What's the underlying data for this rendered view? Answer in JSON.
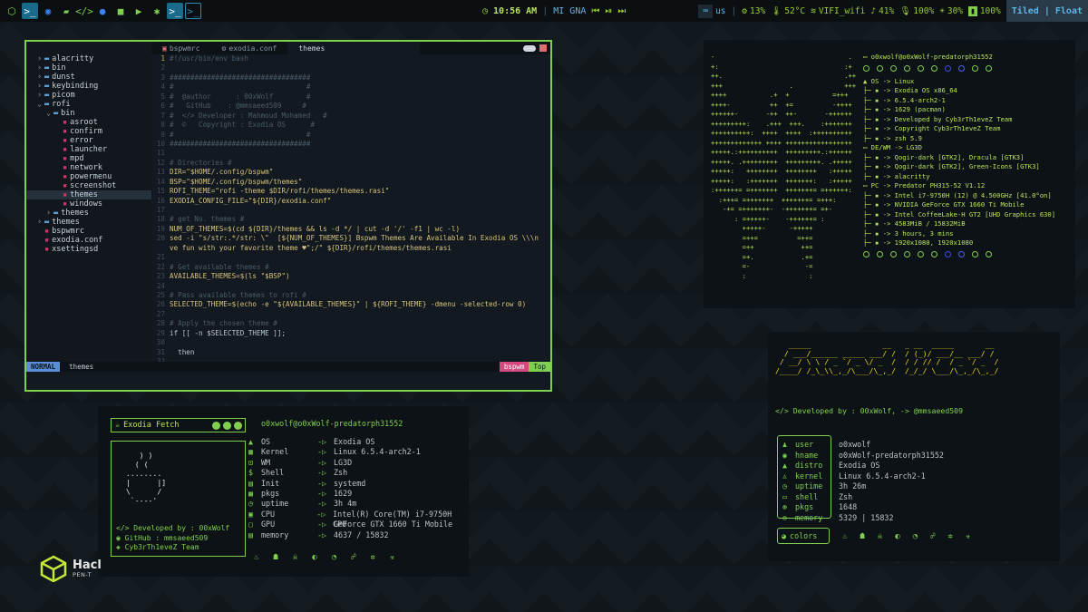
{
  "topbar": {
    "clock": "10:56 AM",
    "media": "MI GNA",
    "keyboard": "us",
    "cpu": "13%",
    "temp": "52°C",
    "wifi": "VIFI_wifi",
    "volume": "41%",
    "mic": "100%",
    "brightness": "30%",
    "battery": "100%",
    "layout_mode": "Tiled | Float"
  },
  "editor": {
    "tree": [
      {
        "label": "alacritty",
        "depth": 0,
        "type": "folder",
        "open": false
      },
      {
        "label": "bin",
        "depth": 0,
        "type": "folder",
        "open": false
      },
      {
        "label": "dunst",
        "depth": 0,
        "type": "folder",
        "open": false
      },
      {
        "label": "keybinding",
        "depth": 0,
        "type": "folder",
        "open": false
      },
      {
        "label": "picom",
        "depth": 0,
        "type": "folder",
        "open": false
      },
      {
        "label": "rofi",
        "depth": 0,
        "type": "folder",
        "open": true
      },
      {
        "label": "bin",
        "depth": 1,
        "type": "folder",
        "open": true
      },
      {
        "label": "asroot",
        "depth": 2,
        "type": "file"
      },
      {
        "label": "confirm",
        "depth": 2,
        "type": "file"
      },
      {
        "label": "error",
        "depth": 2,
        "type": "file"
      },
      {
        "label": "launcher",
        "depth": 2,
        "type": "file"
      },
      {
        "label": "mpd",
        "depth": 2,
        "type": "file"
      },
      {
        "label": "network",
        "depth": 2,
        "type": "file"
      },
      {
        "label": "powermenu",
        "depth": 2,
        "type": "file"
      },
      {
        "label": "screenshot",
        "depth": 2,
        "type": "file"
      },
      {
        "label": "themes",
        "depth": 2,
        "type": "file",
        "selected": true
      },
      {
        "label": "windows",
        "depth": 2,
        "type": "file"
      },
      {
        "label": "themes",
        "depth": 1,
        "type": "folder",
        "open": false
      },
      {
        "label": "themes",
        "depth": 0,
        "type": "folder",
        "open": false
      },
      {
        "label": "bspwmrc",
        "depth": 0,
        "type": "file"
      },
      {
        "label": "exodia.conf",
        "depth": 0,
        "type": "file"
      },
      {
        "label": "xsettingsd",
        "depth": 0,
        "type": "file"
      }
    ],
    "tabs": [
      "bspwmrc",
      "exodia.conf",
      "themes"
    ],
    "code": [
      {
        "n": "1",
        "t": "#!/usr/bin/env bash",
        "c": "com"
      },
      {
        "n": "2",
        "t": "",
        "c": ""
      },
      {
        "n": "3",
        "t": "##################################",
        "c": "com"
      },
      {
        "n": "4",
        "t": "#                                #",
        "c": "com"
      },
      {
        "n": "5",
        "t": "#  @author      : 00xWolf        #",
        "c": "com"
      },
      {
        "n": "6",
        "t": "#   GitHub    : @mmsaeed509     #",
        "c": "com"
      },
      {
        "n": "7",
        "t": "#  </> Developer : Mahmoud Mohamed   #",
        "c": "com"
      },
      {
        "n": "8",
        "t": "#  ©   Copyright : Exodia OS      #",
        "c": "com"
      },
      {
        "n": "9",
        "t": "#                                #",
        "c": "com"
      },
      {
        "n": "10",
        "t": "##################################",
        "c": "com"
      },
      {
        "n": "11",
        "t": "",
        "c": ""
      },
      {
        "n": "12",
        "t": "# Directories #",
        "c": "com"
      },
      {
        "n": "13",
        "t": "DIR=\"$HOME/.config/bspwm\"",
        "c": "str"
      },
      {
        "n": "14",
        "t": "BSP=\"$HOME/.config/bspwm/themes\"",
        "c": "str"
      },
      {
        "n": "15",
        "t": "ROFI_THEME=\"rofi -theme $DIR/rofi/themes/themes.rasi\"",
        "c": "str"
      },
      {
        "n": "16",
        "t": "EXODIA_CONFIG_FILE=\"${DIR}/exodia.conf\"",
        "c": "str"
      },
      {
        "n": "17",
        "t": "",
        "c": ""
      },
      {
        "n": "18",
        "t": "# get No. themes #",
        "c": "com"
      },
      {
        "n": "19",
        "t": "NUM_OF_THEMES=$(cd ${DIR}/themes && ls -d */ | cut -d '/' -f1 | wc -l)",
        "c": "str"
      },
      {
        "n": "20",
        "t": "sed -i \"s/str:.*/str: \\\"  [${NUM_OF_THEMES}] Bspwm Themes Are Available In Exodia OS \\\\\\n   Ha",
        "c": "str"
      },
      {
        "n": "",
        "t": "ve fun with your favorite theme ♥\";/\" ${DIR}/rofi/themes/themes.rasi",
        "c": "str"
      },
      {
        "n": "21",
        "t": "",
        "c": ""
      },
      {
        "n": "22",
        "t": "# Get available themes #",
        "c": "com"
      },
      {
        "n": "23",
        "t": "AVAILABLE_THEMES=$(ls \"$BSP\")",
        "c": "str"
      },
      {
        "n": "24",
        "t": "",
        "c": ""
      },
      {
        "n": "25",
        "t": "# Pass available themes to rofi #",
        "c": "com"
      },
      {
        "n": "26",
        "t": "SELECTED_THEME=$(echo -e \"${AVAILABLE_THEMES}\" | ${ROFI_THEME} -dmenu -selected-row 0)",
        "c": "str"
      },
      {
        "n": "27",
        "t": "",
        "c": ""
      },
      {
        "n": "28",
        "t": "# Apply the chosen theme #",
        "c": "com"
      },
      {
        "n": "29",
        "t": "if [[ -n $SELECTED_THEME ]];",
        "c": ""
      },
      {
        "n": "30",
        "t": "",
        "c": ""
      },
      {
        "n": "31",
        "t": "  then",
        "c": ""
      },
      {
        "n": "32",
        "t": "",
        "c": ""
      },
      {
        "n": "33",
        "t": "    THEME_PATH=\"$BSP/$SELECTED_THEME\"",
        "c": "str"
      }
    ],
    "status": {
      "mode": "NORMAL",
      "file": "themes",
      "branch": "bspwm",
      "position": "Top"
    }
  },
  "neofetch": {
    "art": "-                                  .\n+:                                :+\n++.                               .++\n+++                 .             +++\n++++           .+  +           =+++\n++++-          ++  +=          -++++\n++++++-       -++  ++-       -++++++\n+++++++++:    .+++  +++.    :+++++++\n++++++++++:  ++++  ++++  :++++++++++\n+++++++++++++ ++++ +++++++++++++++++\n+++++.:++++++++++  +++++++++.:++++++\n+++++. .+++++++++  +++++++++. .+++++\n+++++:   ++++++++  ++++++++   :+++++\n+++++:   :+++++++  +++++++:   :+++++\n:++++++= =+++++++  +++++++= =++++++:\n  :+++= =+++++++  +++++++= =+++:\n   -+= =+++++++-  -+++++++= =+-\n      : =+++++-    -++++++= :\n        +++++-      -+++++\n        =++=          =++=\n        =++            ++=\n        =+.            .+=\n        =-              -=\n        :                :",
    "user": "o0xwolf@o0xWolf-predatorph31552",
    "sections": [
      {
        "head": "OS",
        "items": [
          "Linux",
          "Exodia OS x86_64",
          "6.5.4-arch2-1",
          "1629 (pacman)",
          "Developed by Cyb3rTh1eveZ Team",
          "Copyright Cyb3rTh1eveZ Team",
          "zsh 5.9"
        ]
      },
      {
        "head": "DE/WM",
        "items": [
          "LG3D",
          "Qogir-dark [GTK2], Dracula [GTK3]",
          "Qogir-dark [GTK2], Green-Icons [GTK3]",
          "alacritty"
        ]
      },
      {
        "head": "PC",
        "items": [
          "Predator PH315-52 V1.12",
          "Intel i7-9750H (12) @ 4.500GHz [41.0°on]",
          "NVIDIA GeForce GTX 1660 Ti Mobile",
          "Intel CoffeeLake-H GT2 [UHD Graphics 630]",
          "4583MiB / 15832MiB",
          "3 hours, 3 mins",
          "1920x1080, 1920x1080"
        ]
      }
    ]
  },
  "fetch1": {
    "title": "Exodia Fetch",
    "art": "     ) )\n    ( (\n  ........\n  |      |]\n  \\      /\n   `----'",
    "credits": [
      "Developed by : 00xWolf",
      "GitHub : mmsaeed509",
      "Cyb3rTh1eveZ Team"
    ],
    "user": "o0xwolf@o0xWolf-predatorph31552",
    "rows": [
      {
        "k": "OS",
        "v": "Exodia OS"
      },
      {
        "k": "Kernel",
        "v": "Linux 6.5.4-arch2-1"
      },
      {
        "k": "WM",
        "v": "LG3D"
      },
      {
        "k": "Shell",
        "v": "Zsh"
      },
      {
        "k": "Init",
        "v": "systemd"
      },
      {
        "k": "pkgs",
        "v": "1629"
      },
      {
        "k": "uptime",
        "v": "3h 4m"
      },
      {
        "k": "CPU",
        "v": "Intel(R) Core(TM) i7-9750H CPU"
      },
      {
        "k": "GPU",
        "v": "GeForce GTX 1660 Ti Mobile"
      },
      {
        "k": "memory",
        "v": "4637 / 15832"
      }
    ]
  },
  "fetch2": {
    "banner": "   _____                __   _ __  _____       __\n  / ___/______ _____ ___/ /  / (_)/ ___/__ ___/ /\n / __/ \\ \\ / _ `/ _ \\/ _  /  / / // /  / _ `/ _  /\n/____/ /_\\_\\\\_,_/\\___/\\_,_/  /_/_/ \\___/\\_,_/\\_,_/",
    "dev": "</> Developed by : 00xWolf,  -> @mmsaeed509",
    "rows": [
      {
        "k": "user",
        "v": "o0xwolf"
      },
      {
        "k": "hname",
        "v": "o0xWolf-predatorph31552"
      },
      {
        "k": "distro",
        "v": "Exodia OS"
      },
      {
        "k": "kernel",
        "v": "Linux 6.5.4-arch2-1"
      },
      {
        "k": "uptime",
        "v": "3h 26m"
      },
      {
        "k": "shell",
        "v": "Zsh"
      },
      {
        "k": "pkgs",
        "v": "1648"
      },
      {
        "k": "memory",
        "v": "5329 | 15832"
      }
    ],
    "colors_label": "colors"
  },
  "logo": {
    "title": "Hacl",
    "subtitle": "PEN-T"
  }
}
